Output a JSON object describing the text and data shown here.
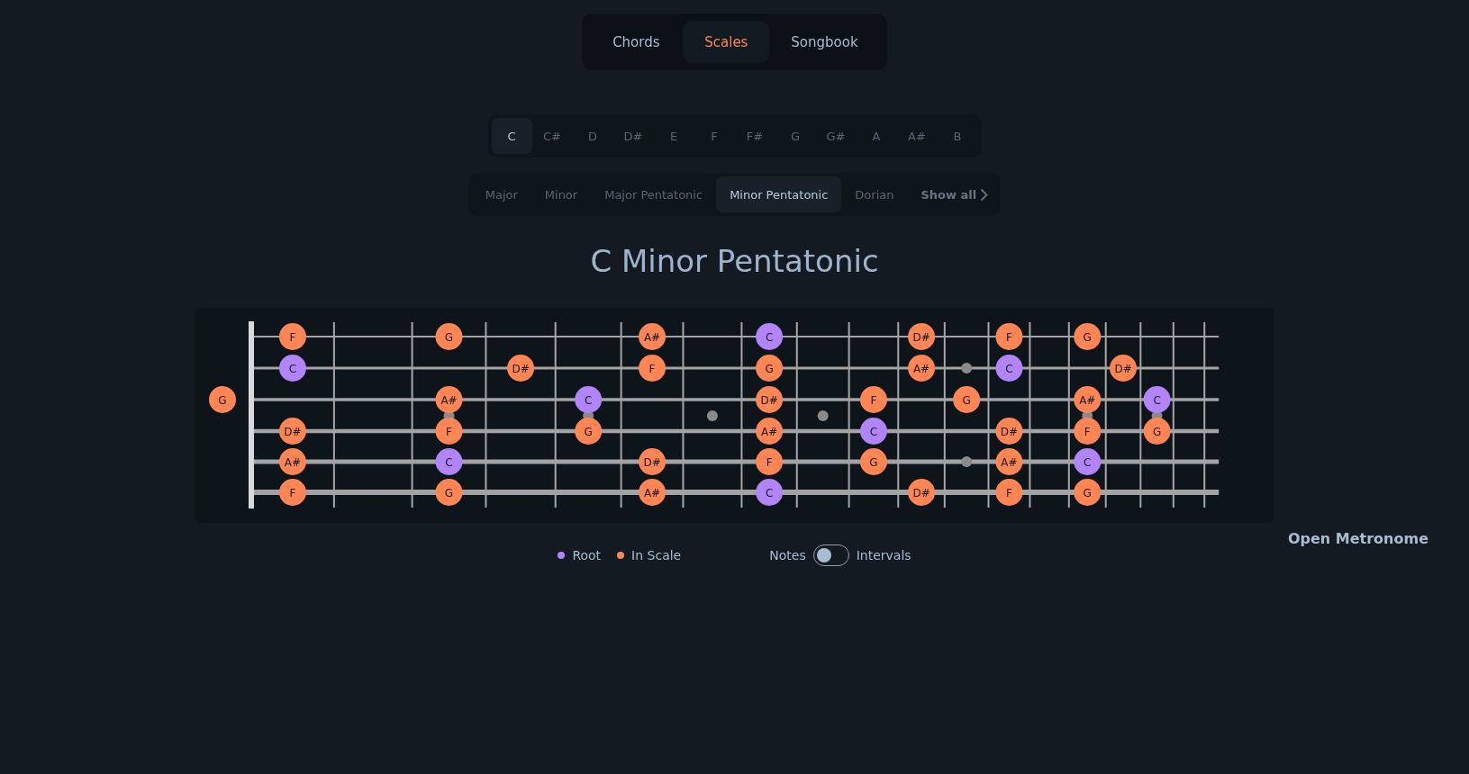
{
  "nav_tabs": [
    {
      "label": "Chords",
      "selected": false
    },
    {
      "label": "Scales",
      "selected": true
    },
    {
      "label": "Songbook",
      "selected": false
    }
  ],
  "keys": [
    {
      "label": "C",
      "selected": true
    },
    {
      "label": "C#",
      "selected": false
    },
    {
      "label": "D",
      "selected": false
    },
    {
      "label": "D#",
      "selected": false
    },
    {
      "label": "E",
      "selected": false
    },
    {
      "label": "F",
      "selected": false
    },
    {
      "label": "F#",
      "selected": false
    },
    {
      "label": "G",
      "selected": false
    },
    {
      "label": "G#",
      "selected": false
    },
    {
      "label": "A",
      "selected": false
    },
    {
      "label": "A#",
      "selected": false
    },
    {
      "label": "B",
      "selected": false
    }
  ],
  "scales": [
    {
      "label": "Major",
      "selected": false
    },
    {
      "label": "Minor",
      "selected": false
    },
    {
      "label": "Major Pentatonic",
      "selected": false
    },
    {
      "label": "Minor Pentatonic",
      "selected": true
    },
    {
      "label": "Dorian",
      "selected": false
    }
  ],
  "show_all": "Show all",
  "title": "C Minor Pentatonic",
  "fretboard": {
    "strings": [
      {
        "slots": [
          {
            "kind": "empty"
          },
          {
            "kind": "note",
            "label": "F",
            "color": "#ff8555"
          },
          {
            "kind": "empty"
          },
          {
            "kind": "note",
            "label": "G",
            "color": "#ff8555"
          },
          {
            "kind": "empty"
          },
          {
            "kind": "empty"
          },
          {
            "kind": "note",
            "label": "A#",
            "color": "#ff8555"
          },
          {
            "kind": "empty"
          },
          {
            "kind": "note",
            "label": "C",
            "color": "#b185f7"
          },
          {
            "kind": "empty"
          },
          {
            "kind": "empty"
          },
          {
            "kind": "note",
            "label": "D#",
            "color": "#ff8555"
          },
          {
            "kind": "empty"
          },
          {
            "kind": "note",
            "label": "F",
            "color": "#ff8555"
          },
          {
            "kind": "empty"
          },
          {
            "kind": "note",
            "label": "G",
            "color": "#ff8555"
          },
          {
            "kind": "empty"
          },
          {
            "kind": "empty"
          },
          {
            "kind": "empty"
          }
        ]
      },
      {
        "slots": [
          {
            "kind": "empty"
          },
          {
            "kind": "note",
            "label": "C",
            "color": "#b185f7"
          },
          {
            "kind": "empty"
          },
          {
            "kind": "empty"
          },
          {
            "kind": "note",
            "label": "D#",
            "color": "#ff8555"
          },
          {
            "kind": "empty"
          },
          {
            "kind": "note",
            "label": "F",
            "color": "#ff8555"
          },
          {
            "kind": "empty"
          },
          {
            "kind": "note",
            "label": "G",
            "color": "#ff8555"
          },
          {
            "kind": "empty"
          },
          {
            "kind": "empty"
          },
          {
            "kind": "note",
            "label": "A#",
            "color": "#ff8555"
          },
          {
            "kind": "empty"
          },
          {
            "kind": "note",
            "label": "C",
            "color": "#b185f7"
          },
          {
            "kind": "empty"
          },
          {
            "kind": "empty"
          },
          {
            "kind": "note",
            "label": "D#",
            "color": "#ff8555"
          },
          {
            "kind": "empty"
          },
          {
            "kind": "empty"
          }
        ]
      },
      {
        "slots": [
          {
            "kind": "note",
            "label": "G",
            "color": "#ff8555"
          },
          {
            "kind": "empty"
          },
          {
            "kind": "empty"
          },
          {
            "kind": "note",
            "label": "A#",
            "color": "#ff8555"
          },
          {
            "kind": "empty"
          },
          {
            "kind": "note",
            "label": "C",
            "color": "#b185f7"
          },
          {
            "kind": "empty"
          },
          {
            "kind": "empty"
          },
          {
            "kind": "note",
            "label": "D#",
            "color": "#ff8555"
          },
          {
            "kind": "empty"
          },
          {
            "kind": "note",
            "label": "F",
            "color": "#ff8555"
          },
          {
            "kind": "empty"
          },
          {
            "kind": "note",
            "label": "G",
            "color": "#ff8555"
          },
          {
            "kind": "empty"
          },
          {
            "kind": "empty"
          },
          {
            "kind": "note",
            "label": "A#",
            "color": "#ff8555"
          },
          {
            "kind": "empty"
          },
          {
            "kind": "note",
            "label": "C",
            "color": "#b185f7"
          },
          {
            "kind": "empty"
          }
        ]
      },
      {
        "slots": [
          {
            "kind": "empty"
          },
          {
            "kind": "note",
            "label": "D#",
            "color": "#ff8555"
          },
          {
            "kind": "empty"
          },
          {
            "kind": "note",
            "label": "F",
            "color": "#ff8555"
          },
          {
            "kind": "empty"
          },
          {
            "kind": "note",
            "label": "G",
            "color": "#ff8555"
          },
          {
            "kind": "empty"
          },
          {
            "kind": "empty"
          },
          {
            "kind": "note",
            "label": "A#",
            "color": "#ff8555"
          },
          {
            "kind": "empty"
          },
          {
            "kind": "note",
            "label": "C",
            "color": "#b185f7"
          },
          {
            "kind": "empty"
          },
          {
            "kind": "empty"
          },
          {
            "kind": "note",
            "label": "D#",
            "color": "#ff8555"
          },
          {
            "kind": "empty"
          },
          {
            "kind": "note",
            "label": "F",
            "color": "#ff8555"
          },
          {
            "kind": "empty"
          },
          {
            "kind": "note",
            "label": "G",
            "color": "#ff8555"
          },
          {
            "kind": "empty"
          }
        ]
      },
      {
        "slots": [
          {
            "kind": "empty"
          },
          {
            "kind": "note",
            "label": "A#",
            "color": "#ff8555"
          },
          {
            "kind": "empty"
          },
          {
            "kind": "note",
            "label": "C",
            "color": "#b185f7"
          },
          {
            "kind": "empty"
          },
          {
            "kind": "empty"
          },
          {
            "kind": "note",
            "label": "D#",
            "color": "#ff8555"
          },
          {
            "kind": "empty"
          },
          {
            "kind": "note",
            "label": "F",
            "color": "#ff8555"
          },
          {
            "kind": "empty"
          },
          {
            "kind": "note",
            "label": "G",
            "color": "#ff8555"
          },
          {
            "kind": "empty"
          },
          {
            "kind": "empty"
          },
          {
            "kind": "note",
            "label": "A#",
            "color": "#ff8555"
          },
          {
            "kind": "empty"
          },
          {
            "kind": "note",
            "label": "C",
            "color": "#b185f7"
          },
          {
            "kind": "empty"
          },
          {
            "kind": "empty"
          },
          {
            "kind": "empty"
          }
        ]
      },
      {
        "slots": [
          {
            "kind": "empty"
          },
          {
            "kind": "note",
            "label": "F",
            "color": "#ff8555"
          },
          {
            "kind": "empty"
          },
          {
            "kind": "note",
            "label": "G",
            "color": "#ff8555"
          },
          {
            "kind": "empty"
          },
          {
            "kind": "empty"
          },
          {
            "kind": "note",
            "label": "A#",
            "color": "#ff8555"
          },
          {
            "kind": "empty"
          },
          {
            "kind": "note",
            "label": "C",
            "color": "#b185f7"
          },
          {
            "kind": "empty"
          },
          {
            "kind": "empty"
          },
          {
            "kind": "note",
            "label": "D#",
            "color": "#ff8555"
          },
          {
            "kind": "empty"
          },
          {
            "kind": "note",
            "label": "F",
            "color": "#ff8555"
          },
          {
            "kind": "empty"
          },
          {
            "kind": "note",
            "label": "G",
            "color": "#ff8555"
          },
          {
            "kind": "empty"
          },
          {
            "kind": "empty"
          },
          {
            "kind": "empty"
          }
        ]
      }
    ]
  },
  "legend": [
    {
      "label": "Root",
      "color": "#b185f7"
    },
    {
      "label": "In Scale",
      "color": "#ff8555"
    }
  ],
  "toggle": {
    "left_label": "Notes",
    "right_label": "Intervals",
    "on": false
  },
  "metronome_link": "Open Metronome"
}
